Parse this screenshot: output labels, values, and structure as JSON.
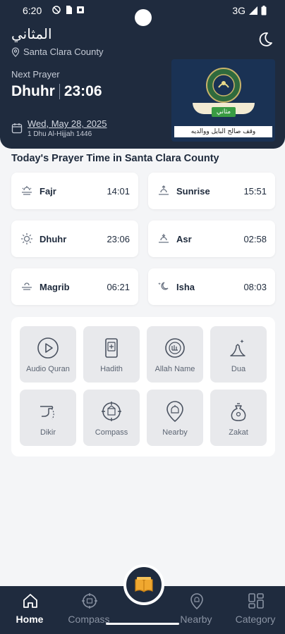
{
  "status_bar": {
    "time": "6:20",
    "network": "3G"
  },
  "header": {
    "app_title": "المثاني",
    "location": "Santa Clara County",
    "next_prayer_label": "Next Prayer",
    "next_prayer_name": "Dhuhr",
    "next_prayer_time": "23:06",
    "gregorian_date": "Wed, May 28, 2025",
    "hijri_date": "1 Dhu Al-Hijjah 1446",
    "banner_caption": "وقف صالح البايل ووالديه",
    "banner_tag": "مثاني"
  },
  "section_title": "Today's Prayer Time in Santa Clara County",
  "prayers": [
    {
      "name": "Fajr",
      "time": "14:01",
      "icon": "fajr-icon"
    },
    {
      "name": "Sunrise",
      "time": "15:51",
      "icon": "sunrise-icon"
    },
    {
      "name": "Dhuhr",
      "time": "23:06",
      "icon": "dhuhr-icon"
    },
    {
      "name": "Asr",
      "time": "02:58",
      "icon": "asr-icon"
    },
    {
      "name": "Magrib",
      "time": "06:21",
      "icon": "magrib-icon"
    },
    {
      "name": "Isha",
      "time": "08:03",
      "icon": "isha-icon"
    }
  ],
  "features": [
    {
      "label": "Audio Quran",
      "icon": "play-circle-icon"
    },
    {
      "label": "Hadith",
      "icon": "book-icon"
    },
    {
      "label": "Allah Name",
      "icon": "allah-name-icon"
    },
    {
      "label": "Dua",
      "icon": "dua-hands-icon"
    },
    {
      "label": "Dikir",
      "icon": "dikir-hand-icon"
    },
    {
      "label": "Compass",
      "icon": "compass-icon"
    },
    {
      "label": "Nearby",
      "icon": "nearby-mosque-icon"
    },
    {
      "label": "Zakat",
      "icon": "zakat-bag-icon"
    }
  ],
  "nav": {
    "home": "Home",
    "compass": "Compass",
    "nearby": "Nearby",
    "category": "Category"
  },
  "colors": {
    "header_bg": "#1f2b3e",
    "page_bg": "#f4f5f7",
    "tile_bg": "#e8e9ec"
  }
}
